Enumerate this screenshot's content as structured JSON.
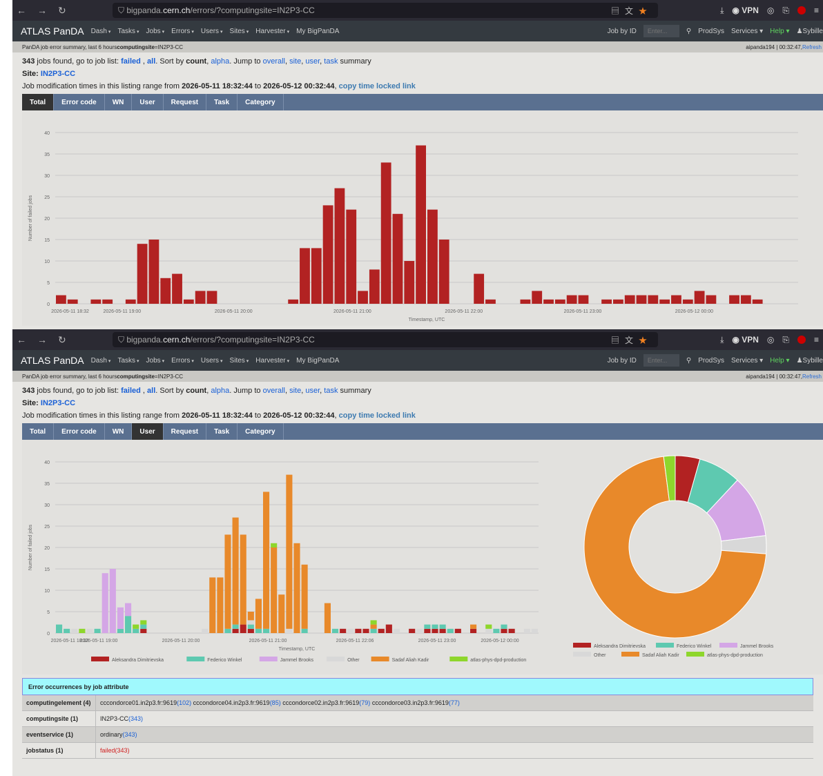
{
  "browser": {
    "url_prefix": "bigpanda.",
    "url_host": "cern.ch",
    "url_path": "/errors/?computingsite=IN2P3-CC",
    "vpn_label": "VPN"
  },
  "nav": {
    "brand": "ATLAS PanDA",
    "menu": [
      "Dash",
      "Tasks",
      "Jobs",
      "Errors",
      "Users",
      "Sites",
      "Harvester",
      "My BigPanDA"
    ],
    "job_by_id": "Job by ID",
    "job_placeholder": "Enter...",
    "prodsys": "ProdSys",
    "services": "Services",
    "help": "Help",
    "user": "Sybille"
  },
  "shot1": {
    "crumb_text": "PanDA job error summary, last 6 hours ",
    "crumb_bold": "computingsite",
    "crumb_value": "=IN2P3-CC",
    "server": "aipanda194 | 00:32:47,",
    "refresh": "Refresh"
  },
  "shot2": {
    "server": "aipanda194 | 00:32:47,",
    "refresh": "Refresh"
  },
  "info": {
    "count": "343",
    "t1": " jobs found, go to job list: ",
    "failed": "failed",
    "comma": " , ",
    "all": "all",
    "t2": ". Sort by ",
    "count_sort": "count",
    "comma2": ", ",
    "alpha": "alpha",
    "t3": ". Jump to ",
    "overall": "overall",
    "site": "site",
    "user": "user",
    "task": "task",
    "summary": " summary",
    "site_label": "Site: ",
    "site_value": "IN2P3-CC",
    "range_prefix": "Job modification times in this listing range from ",
    "range_from": "2026-05-11 18:32:44",
    "range_to_word": " to ",
    "range_to": "2026-05-12 00:32:44",
    "copy_link": "copy time locked link"
  },
  "tabs": [
    "Total",
    "Error code",
    "WN",
    "User",
    "Request",
    "Task",
    "Category"
  ],
  "chart_data": [
    {
      "type": "bar",
      "title": "",
      "ylabel": "Number of failed jobs",
      "xlabel": "Timestamp, UTC",
      "ylim": [
        0,
        40
      ],
      "yticks": [
        0,
        5,
        10,
        15,
        20,
        25,
        30,
        35,
        40
      ],
      "xtick_labels": [
        "2026-05-11 18:32",
        "2026-05-11 19:00",
        "2026-05-11 20:00",
        "2026-05-11 21:00",
        "2026-05-11 22:00",
        "2026-05-11 23:00",
        "2026-05-12 00:00"
      ],
      "x_first_bin": "2026-05-11 18:35",
      "bin_minutes": 5,
      "values": [
        2,
        1,
        0,
        1,
        1,
        0,
        1,
        14,
        15,
        6,
        7,
        1,
        3,
        3,
        0,
        0,
        0,
        0,
        0,
        0,
        1,
        13,
        13,
        23,
        27,
        22,
        3,
        8,
        33,
        21,
        10,
        37,
        22,
        15,
        0,
        0,
        7,
        1,
        0,
        0,
        1,
        3,
        1,
        1,
        2,
        2,
        0,
        1,
        1,
        2,
        2,
        2,
        1,
        2,
        1,
        3,
        2,
        0,
        2,
        2,
        1,
        0,
        0,
        0
      ],
      "color": "#b22222",
      "grid": true
    },
    {
      "type": "bar",
      "stacked": true,
      "title": "",
      "ylabel": "Number of failed jobs",
      "xlabel": "Timestamp, UTC",
      "ylim": [
        0,
        40
      ],
      "yticks": [
        0,
        5,
        10,
        15,
        20,
        25,
        30,
        35,
        40
      ],
      "xtick_labels": [
        "2026-05-11 18:32",
        "2026-05-11 19:00",
        "2026-05-11 20:00",
        "2026-05-11 21:00",
        "2026-05-11 22:06",
        "2026-05-11 23:00",
        "2026-05-12 00:00"
      ],
      "series": [
        {
          "name": "Aleksandra Dimitrievska",
          "color": "#b22222",
          "values": [
            0,
            0,
            0,
            0,
            0,
            0,
            0,
            0,
            0,
            0,
            0,
            1,
            0,
            0,
            0,
            0,
            0,
            0,
            0,
            0,
            0,
            0,
            0,
            1,
            2,
            1,
            0,
            0,
            0,
            0,
            0,
            0,
            0,
            0,
            0,
            0,
            0,
            1,
            0,
            1,
            1,
            0,
            1,
            2,
            0,
            0,
            1,
            0,
            1,
            1,
            1,
            0,
            1,
            0,
            1,
            0,
            0,
            0,
            1,
            1,
            0,
            0,
            0
          ]
        },
        {
          "name": "Federico Winkel",
          "color": "#5ec9b0",
          "values": [
            2,
            1,
            0,
            0,
            0,
            1,
            0,
            0,
            1,
            4,
            1,
            1,
            0,
            0,
            0,
            0,
            0,
            0,
            0,
            0,
            0,
            0,
            1,
            1,
            0,
            1,
            1,
            1,
            0,
            0,
            0,
            0,
            1,
            0,
            0,
            0,
            1,
            0,
            0,
            0,
            0,
            1,
            0,
            0,
            0,
            0,
            0,
            0,
            1,
            1,
            1,
            1,
            0,
            0,
            0,
            0,
            0,
            1,
            1,
            0,
            0,
            0,
            0
          ]
        },
        {
          "name": "Jammel Brooks",
          "color": "#d4a6e6",
          "values": [
            0,
            0,
            0,
            0,
            0,
            0,
            14,
            15,
            5,
            3,
            0,
            0,
            0,
            0,
            0,
            0,
            0,
            0,
            0,
            0,
            0,
            0,
            0,
            0,
            0,
            0,
            0,
            0,
            0,
            0,
            0,
            0,
            0,
            0,
            0,
            0,
            0,
            0,
            0,
            0,
            0,
            0,
            0,
            0,
            0,
            0,
            0,
            0,
            0,
            0,
            0,
            0,
            0,
            0,
            0,
            0,
            0,
            0,
            0,
            0,
            0,
            0,
            0
          ]
        },
        {
          "name": "Other",
          "color": "#d8d8d8",
          "values": [
            0,
            0,
            1,
            0,
            1,
            0,
            0,
            0,
            0,
            0,
            0,
            0,
            0,
            0,
            0,
            0,
            0,
            0,
            0,
            1,
            0,
            0,
            0,
            0,
            0,
            1,
            0,
            0,
            0,
            0,
            1,
            0,
            0,
            0,
            0,
            0,
            0,
            0,
            1,
            0,
            0,
            0,
            0,
            0,
            1,
            0,
            0,
            1,
            0,
            0,
            0,
            0,
            0,
            0,
            0,
            0,
            1,
            0,
            0,
            0,
            0,
            1,
            1
          ]
        },
        {
          "name": "Sadaf Aliah Kadir",
          "color": "#e8892a",
          "values": [
            0,
            0,
            0,
            0,
            0,
            0,
            0,
            0,
            0,
            0,
            0,
            0,
            0,
            0,
            0,
            0,
            0,
            0,
            0,
            0,
            13,
            13,
            22,
            25,
            21,
            2,
            7,
            32,
            20,
            9,
            36,
            21,
            15,
            0,
            0,
            7,
            0,
            0,
            0,
            0,
            0,
            1,
            0,
            0,
            0,
            0,
            0,
            0,
            0,
            0,
            0,
            0,
            0,
            0,
            1,
            0,
            0,
            0,
            0,
            0,
            0,
            0,
            0
          ]
        },
        {
          "name": "atlas-phys-dpd-production",
          "color": "#8ed62c",
          "values": [
            0,
            0,
            0,
            1,
            0,
            0,
            0,
            0,
            0,
            0,
            1,
            1,
            0,
            0,
            0,
            0,
            0,
            0,
            0,
            0,
            0,
            0,
            0,
            0,
            0,
            0,
            0,
            0,
            1,
            0,
            0,
            0,
            0,
            0,
            0,
            0,
            0,
            0,
            0,
            0,
            0,
            1,
            0,
            0,
            0,
            0,
            0,
            0,
            0,
            0,
            0,
            0,
            0,
            0,
            0,
            0,
            1,
            0,
            0,
            0,
            0,
            0,
            0
          ]
        }
      ]
    },
    {
      "type": "pie",
      "donut": true,
      "labels": [
        "Aleksandra Dimitrievska",
        "Federico Winkel",
        "Jammel Brooks",
        "Other",
        "Sadaf Aliah Kadir",
        "atlas-phys-dpd-production"
      ],
      "values": [
        15,
        26,
        38,
        11,
        246,
        7
      ],
      "colors": [
        "#b22222",
        "#5ec9b0",
        "#d4a6e6",
        "#d8d8d8",
        "#e8892a",
        "#8ed62c"
      ]
    }
  ],
  "errtable": {
    "heading": "Error occurrences by job attribute",
    "rows": [
      {
        "key": "computingelement",
        "count": "(4)",
        "items": [
          {
            "name": "cccondorce01.in2p3.fr:9619",
            "n": "(102)"
          },
          {
            "name": "cccondorce04.in2p3.fr:9619",
            "n": "(85)"
          },
          {
            "name": "cccondorce02.in2p3.fr:9619",
            "n": "(79)"
          },
          {
            "name": "cccondorce03.in2p3.fr:9619",
            "n": "(77)"
          }
        ]
      },
      {
        "key": "computingsite",
        "count": "(1)",
        "items": [
          {
            "name": "IN2P3-CC",
            "n": "(343)"
          }
        ]
      },
      {
        "key": "eventservice",
        "count": "(1)",
        "items": [
          {
            "name": "ordinary",
            "n": "(343)"
          }
        ]
      },
      {
        "key": "jobstatus",
        "count": "(1)",
        "items": [
          {
            "name": "failed",
            "n": "(343)"
          }
        ]
      }
    ]
  }
}
